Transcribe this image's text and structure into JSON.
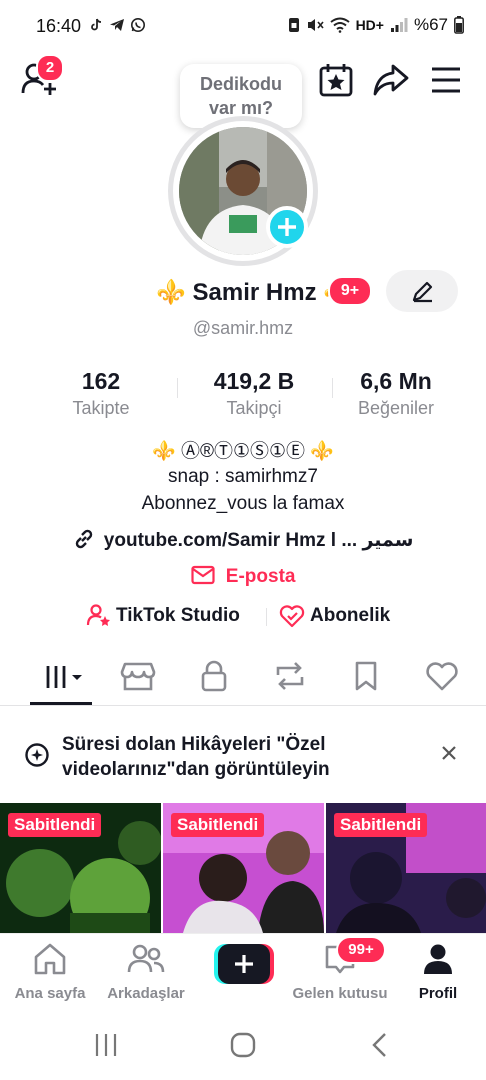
{
  "status": {
    "time": "16:40",
    "battery": "%67",
    "network": "HD+"
  },
  "top_bar": {
    "friend_requests_badge": "2",
    "icons": [
      "add-user-icon",
      "calendar-star-icon",
      "share-icon",
      "menu-icon"
    ]
  },
  "bubble": {
    "text_line1": "Dedikodu",
    "text_line2": "var mı?"
  },
  "profile": {
    "display_name": "⚜️ Samir Hmz ⚜️",
    "name_badge": "9+",
    "username": "@samir.hmz"
  },
  "stats": [
    {
      "value": "162",
      "label": "Takipte"
    },
    {
      "value": "419,2 B",
      "label": "Takipçi"
    },
    {
      "value": "6,6 Mn",
      "label": "Beğeniler"
    }
  ],
  "bio": {
    "line1": "⚜️ Ⓐ®Ⓣ①Ⓢ①Ⓔ ⚜️",
    "line2": "snap : samirhmz7",
    "line3": "Abonnez_vous la famax"
  },
  "link": {
    "text": "youtube.com/Samir Hmz l ... سمير"
  },
  "email": {
    "label": "E-posta"
  },
  "tools": {
    "studio_label": "TikTok Studio",
    "subscription_label": "Abonelik"
  },
  "tabs": [
    "videos-tab",
    "shop-tab",
    "private-tab",
    "repost-tab",
    "favorites-tab",
    "liked-tab"
  ],
  "notice": {
    "text": "Süresi dolan Hikâyeleri \"Özel videolarınız\"dan görüntüleyin"
  },
  "videos": [
    {
      "pin_label": "Sabitlendi"
    },
    {
      "pin_label": "Sabitlendi"
    },
    {
      "pin_label": "Sabitlendi"
    }
  ],
  "nav": {
    "home": "Ana sayfa",
    "friends": "Arkadaşlar",
    "inbox": "Gelen kutusu",
    "inbox_badge": "99+",
    "profile": "Profil"
  },
  "colors": {
    "accent": "#fe2c55",
    "plus_blue": "#20d5ec",
    "text": "#161823",
    "muted": "#8a8b91"
  }
}
